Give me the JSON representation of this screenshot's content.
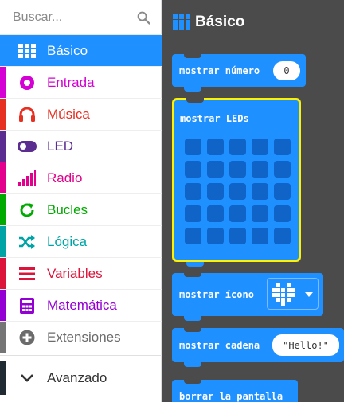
{
  "search": {
    "placeholder": "Buscar..."
  },
  "categories": [
    {
      "label": "Básico",
      "color": "#1E90FF",
      "icon": "grid-icon",
      "active": true
    },
    {
      "label": "Entrada",
      "color": "#D400D4",
      "icon": "input-icon"
    },
    {
      "label": "Música",
      "color": "#E63022",
      "icon": "headphones-icon"
    },
    {
      "label": "LED",
      "color": "#5C2D91",
      "icon": "toggle-icon"
    },
    {
      "label": "Radio",
      "color": "#E3008C",
      "icon": "signal-icon"
    },
    {
      "label": "Bucles",
      "color": "#00AA00",
      "icon": "loop-icon"
    },
    {
      "label": "Lógica",
      "color": "#00A4A6",
      "icon": "shuffle-icon"
    },
    {
      "label": "Variables",
      "color": "#DC143C",
      "icon": "lines-icon"
    },
    {
      "label": "Matemática",
      "color": "#9400D3",
      "icon": "calculator-icon"
    },
    {
      "label": "Extensiones",
      "color": "#757575",
      "icon": "plus-circle-icon"
    }
  ],
  "advanced": {
    "label": "Avanzado",
    "icon": "chevron-down-icon"
  },
  "workspace": {
    "title": "Básico",
    "blocks": {
      "show_number": {
        "label": "mostrar número",
        "value": "0"
      },
      "show_leds": {
        "label": "mostrar LEDs"
      },
      "show_icon": {
        "label": "mostrar ícono"
      },
      "show_string": {
        "label": "mostrar cadena",
        "value": "\"Hello!\""
      },
      "clear_screen": {
        "label": "borrar la pantalla"
      }
    }
  }
}
